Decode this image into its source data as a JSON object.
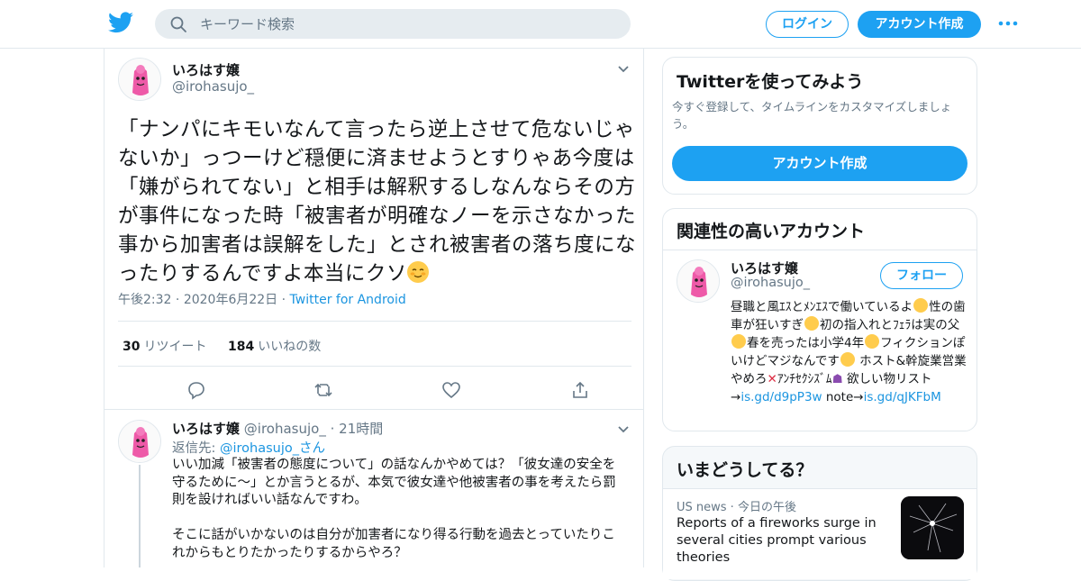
{
  "header": {
    "search_placeholder": "キーワード検索",
    "login_label": "ログイン",
    "signup_label": "アカウント作成",
    "brand_color": "#1da1f2"
  },
  "tweet": {
    "name": "いろはす嬢",
    "handle": "@irohasujo_",
    "text": "「ナンパにキモいなんて言ったら逆上させて危ないじゃないか」っつーけど穏便に済ませようとすりゃあ今度は「嫌がられてない」と相手は解釈するしなんならその方が事件になった時「被害者が明確なノーを示さなかった事から加害者は誤解をした」とされ被害者の落ち度になったりするんですよ本当にクソ",
    "time": "午後2:32",
    "date": "2020年6月22日",
    "source": "Twitter for Android",
    "retweets_count": "30",
    "retweets_label": "リツイート",
    "likes_count": "184",
    "likes_label": "いいねの数"
  },
  "reply": {
    "name": "いろはす嬢",
    "handle": "@irohasujo_",
    "time": "21時間",
    "reply_to_prefix": "返信先: ",
    "reply_to_handle": "@irohasujo_",
    "reply_to_suffix": "さん",
    "text": "いい加減「被害者の態度について」の話なんかやめては？「彼女達の安全を守るために～」とか言うとるが、本気で彼女達や他被害者の事を考えたら罰則を設ければいい話なんですわ。\n\nそこに話がいかないのは自分が加害者になり得る行動を過去とっていたりこれからもとりたかったりするからやろ？"
  },
  "sidebar": {
    "try_title": "Twitterを使ってみよう",
    "try_sub": "今すぐ登録して、タイムラインをカスタマイズしましょう。",
    "try_button": "アカウント作成",
    "related_title": "関連性の高いアカウント",
    "related": {
      "name": "いろはす嬢",
      "handle": "@irohasujo_",
      "follow_label": "フォロー",
      "bio_1": "昼職と風ｴｽとﾒﾝｴｽで働いているよ",
      "bio_2": "性の歯車が狂いすぎ",
      "bio_3": "初の指入れとﾌｪﾗは実の父",
      "bio_4": "春を売ったは小学4年",
      "bio_5": "フィクションぽいけどマジなんです",
      "bio_6": " ホスト&幹旋業営業やめろ",
      "bio_7": "ｱﾝﾁｾｸｼｽﾞﾑ",
      "bio_8": " 欲しい物リスト→",
      "bio_link1": "is.gd/d9pP3w",
      "bio_9": " note→",
      "bio_link2": "is.gd/qJKFbM"
    },
    "now_title": "いまどうしてる？",
    "news": {
      "source": "US news",
      "when": "今日の午後",
      "title": "Reports of a fireworks surge in several cities prompt various theories"
    }
  }
}
